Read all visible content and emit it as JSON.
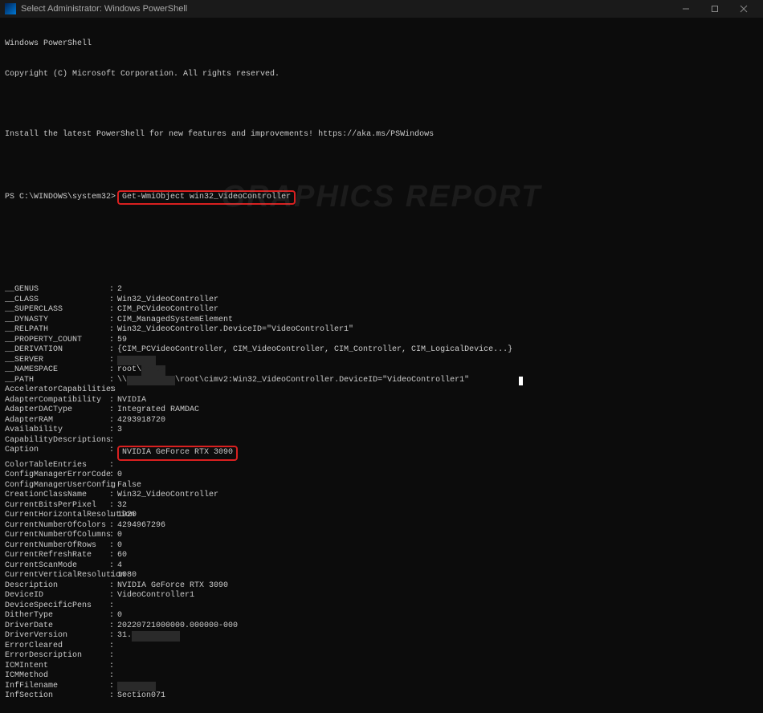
{
  "titlebar": {
    "title": "Select Administrator: Windows PowerShell"
  },
  "intro": {
    "line1": "Windows PowerShell",
    "line2": "Copyright (C) Microsoft Corporation. All rights reserved.",
    "line3": "Install the latest PowerShell for new features and improvements! https://aka.ms/PSWindows"
  },
  "prompt": {
    "prefix": "PS C:\\WINDOWS\\system32>",
    "command": "Get-WmiObject win32_VideoController"
  },
  "props": [
    {
      "k": "__GENUS",
      "v": "2"
    },
    {
      "k": "__CLASS",
      "v": "Win32_VideoController"
    },
    {
      "k": "__SUPERCLASS",
      "v": "CIM_PCVideoController"
    },
    {
      "k": "__DYNASTY",
      "v": "CIM_ManagedSystemElement"
    },
    {
      "k": "__RELPATH",
      "v": "Win32_VideoController.DeviceID=\"VideoController1\""
    },
    {
      "k": "__PROPERTY_COUNT",
      "v": "59"
    },
    {
      "k": "__DERIVATION",
      "v": "{CIM_PCVideoController, CIM_VideoController, CIM_Controller, CIM_LogicalDevice...}"
    },
    {
      "k": "__SERVER",
      "v": "",
      "redact": true
    },
    {
      "k": "__NAMESPACE",
      "v": "root\\cimv2",
      "partredact": true
    },
    {
      "k": "__PATH",
      "v": "\\\\          \\root\\cimv2:Win32_VideoController.DeviceID=\"VideoController1\"",
      "pathredact": true,
      "cursor": true
    },
    {
      "k": "AcceleratorCapabilities",
      "v": ""
    },
    {
      "k": "AdapterCompatibility",
      "v": "NVIDIA"
    },
    {
      "k": "AdapterDACType",
      "v": "Integrated RAMDAC"
    },
    {
      "k": "AdapterRAM",
      "v": "4293918720"
    },
    {
      "k": "Availability",
      "v": "3"
    },
    {
      "k": "CapabilityDescriptions",
      "v": ""
    },
    {
      "k": "Caption",
      "v": "NVIDIA GeForce RTX 3090",
      "hl": true
    },
    {
      "k": "ColorTableEntries",
      "v": ""
    },
    {
      "k": "ConfigManagerErrorCode",
      "v": "0"
    },
    {
      "k": "ConfigManagerUserConfig",
      "v": "False"
    },
    {
      "k": "CreationClassName",
      "v": "Win32_VideoController"
    },
    {
      "k": "CurrentBitsPerPixel",
      "v": "32"
    },
    {
      "k": "CurrentHorizontalResolution",
      "v": "1920"
    },
    {
      "k": "CurrentNumberOfColors",
      "v": "4294967296"
    },
    {
      "k": "CurrentNumberOfColumns",
      "v": "0"
    },
    {
      "k": "CurrentNumberOfRows",
      "v": "0"
    },
    {
      "k": "CurrentRefreshRate",
      "v": "60"
    },
    {
      "k": "CurrentScanMode",
      "v": "4"
    },
    {
      "k": "CurrentVerticalResolution",
      "v": "1080"
    },
    {
      "k": "Description",
      "v": "NVIDIA GeForce RTX 3090"
    },
    {
      "k": "DeviceID",
      "v": "VideoController1"
    },
    {
      "k": "DeviceSpecificPens",
      "v": ""
    },
    {
      "k": "DitherType",
      "v": "0"
    },
    {
      "k": "DriverDate",
      "v": "20220721000000.000000-000"
    },
    {
      "k": "DriverVersion",
      "v": "31.          ",
      "verredact": true
    },
    {
      "k": "ErrorCleared",
      "v": ""
    },
    {
      "k": "ErrorDescription",
      "v": ""
    },
    {
      "k": "ICMIntent",
      "v": ""
    },
    {
      "k": "ICMMethod",
      "v": ""
    },
    {
      "k": "InfFilename",
      "v": "       ",
      "redact": true
    },
    {
      "k": "InfSection",
      "v": "Section071"
    }
  ],
  "watermark": "GRAPHICS REPORT"
}
